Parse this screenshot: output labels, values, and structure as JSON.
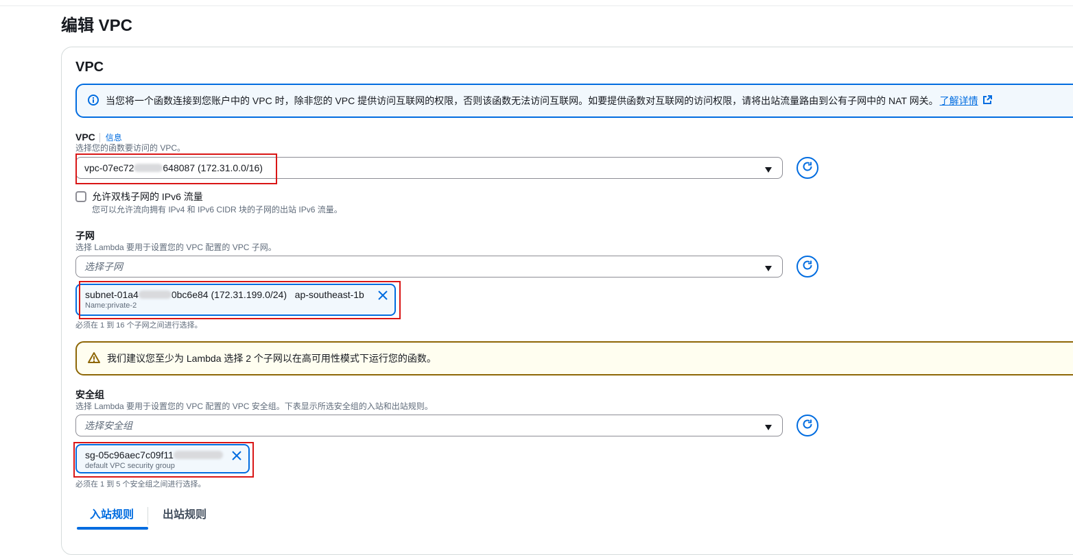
{
  "page_title": "编辑 VPC",
  "section_title": "VPC",
  "info_alert": {
    "message": "当您将一个函数连接到您账户中的 VPC 时，除非您的 VPC 提供访问互联网的权限，否则该函数无法访问互联网。如要提供函数对互联网的访问权限，请将出站流量路由到公有子网中的 NAT 网关。",
    "link": "了解详情",
    "icon": "info-icon",
    "color": "#006ce0"
  },
  "vpc": {
    "label": "VPC",
    "info": "信息",
    "description": "选择您的函数要访问的 VPC。",
    "value_prefix": "vpc-07ec72",
    "value_suffix": "648087 (172.31.0.0/16)"
  },
  "ipv6": {
    "label": "允许双栈子网的 IPv6 流量",
    "description": "您可以允许流向拥有 IPv4 和 IPv6 CIDR 块的子网的出站 IPv6 流量。",
    "checked": false
  },
  "subnet": {
    "label": "子网",
    "description": "选择 Lambda 要用于设置您的 VPC 配置的 VPC 子网。",
    "placeholder": "选择子网",
    "token": {
      "id_prefix": "subnet-01a4",
      "id_suffix": "0bc6e84 (172.31.199.0/24)",
      "az": "ap-southeast-1b",
      "sub": "Name:private-2"
    },
    "hint": "必须在 1 到 16 个子网之间进行选择。"
  },
  "warning_alert": {
    "message": "我们建议您至少为 Lambda 选择 2 个子网以在高可用性模式下运行您的函数。",
    "icon": "warning-icon",
    "color": "#8d6605"
  },
  "security_group": {
    "label": "安全组",
    "description": "选择 Lambda 要用于设置您的 VPC 配置的 VPC 安全组。下表显示所选安全组的入站和出站规则。",
    "placeholder": "选择安全组",
    "token": {
      "id_prefix": "sg-05c96aec7c09f11",
      "sub": "default VPC security group"
    },
    "hint": "必须在 1 到 5 个安全组之间进行选择。"
  },
  "tabs": {
    "inbound": "入站规则",
    "outbound": "出站规则"
  },
  "colors": {
    "accent": "#006ce0",
    "highlight_box": "#d91515"
  }
}
